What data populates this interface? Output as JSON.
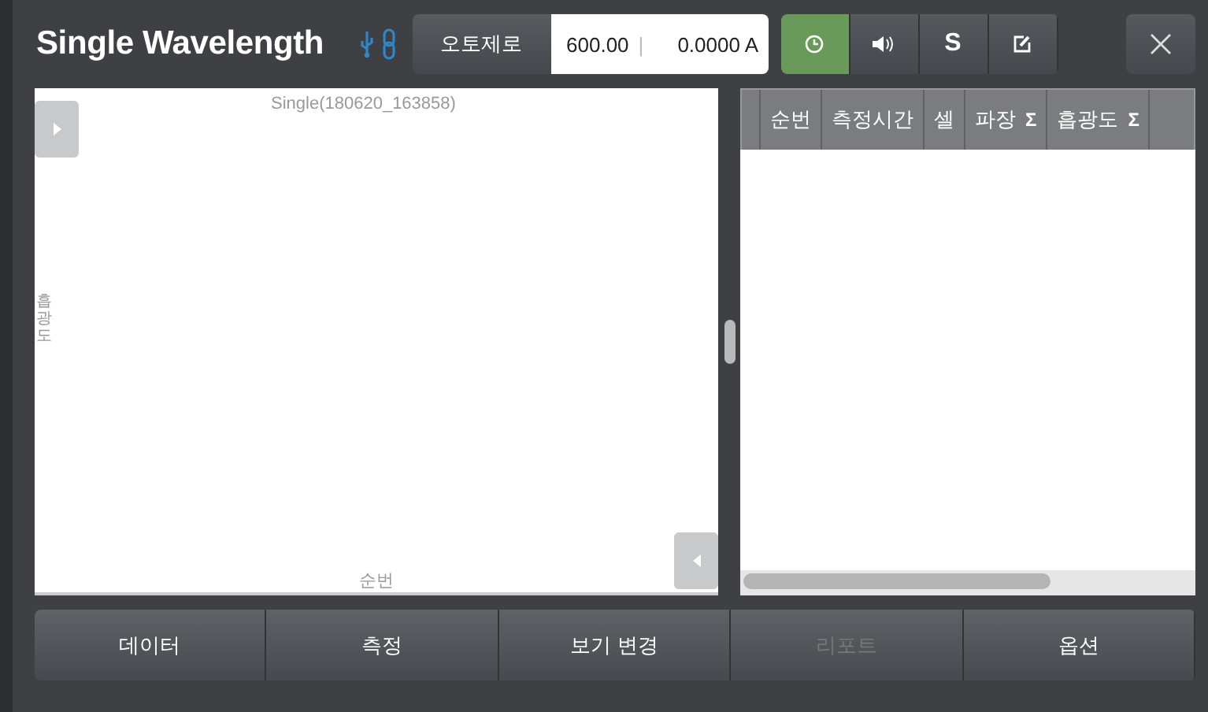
{
  "window": {
    "title": "Single Wavelength"
  },
  "toolbar": {
    "autozero": "오토제로",
    "wavelength": "600.00",
    "separator": "|",
    "absorbance": "0.0000 A",
    "tools": [
      {
        "kind": "clock",
        "selected": true
      },
      {
        "kind": "speaker",
        "selected": false
      },
      {
        "kind": "letter",
        "label": "S",
        "selected": false
      },
      {
        "kind": "edit",
        "selected": false
      }
    ]
  },
  "chart": {
    "title": "Single(180620_163858)",
    "ylabel": "흡광도",
    "xlabel": "순번"
  },
  "table": {
    "columns": [
      {
        "label": "순번"
      },
      {
        "label": "측정시간"
      },
      {
        "label": "셀"
      },
      {
        "label": "파장",
        "sum": "Σ"
      },
      {
        "label": "흡광도",
        "sum": "Σ"
      }
    ]
  },
  "bottom_buttons": [
    {
      "label": "데이터",
      "disabled": false
    },
    {
      "label": "측정",
      "disabled": false
    },
    {
      "label": "보기 변경",
      "disabled": false
    },
    {
      "label": "리포트",
      "disabled": true
    },
    {
      "label": "옵션",
      "disabled": false
    }
  ]
}
